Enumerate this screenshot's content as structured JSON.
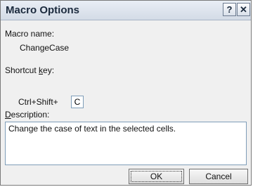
{
  "window": {
    "title": "Macro Options",
    "help_glyph": "?",
    "close_glyph": "✕"
  },
  "macro_name": {
    "label": "Macro name:",
    "value": "ChangeCase"
  },
  "shortcut": {
    "label_prefix": "Shortcut ",
    "label_underlined": "k",
    "label_suffix": "ey:",
    "prefix": "Ctrl+Shift+",
    "key": "C"
  },
  "description": {
    "label_underlined": "D",
    "label_rest": "escription:",
    "value": "Change the case of text in the selected cells."
  },
  "buttons": {
    "ok": "OK",
    "cancel": "Cancel"
  }
}
